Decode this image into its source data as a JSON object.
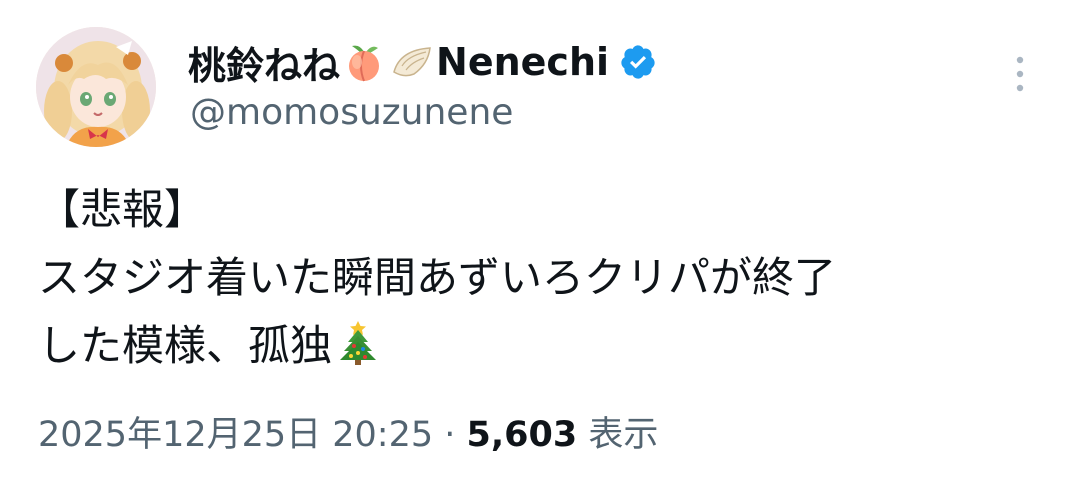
{
  "tweet": {
    "author": {
      "name_prefix": "桃鈴ねね",
      "name_suffix": "Nenechi",
      "emoji_1": "peach-emoji",
      "emoji_2": "dumpling-emoji",
      "verified": true,
      "handle": "@momosuzunene"
    },
    "body": {
      "line1": "【悲報】",
      "line2": "スタジオ着いた瞬間あずいろクリパが終了",
      "line3": "した模様、孤独",
      "line3_emoji": "christmas-tree-emoji"
    },
    "meta": {
      "timestamp": "2025年12月25日 20:25",
      "separator": " · ",
      "views_count": "5,603",
      "views_label": " 表示"
    }
  },
  "colors": {
    "text_primary": "#0f1419",
    "text_secondary": "#536471",
    "verified_blue": "#1d9bf0",
    "background": "#ffffff"
  },
  "icons": {
    "more": "more-vertical-icon",
    "verified": "verified-badge-icon"
  }
}
